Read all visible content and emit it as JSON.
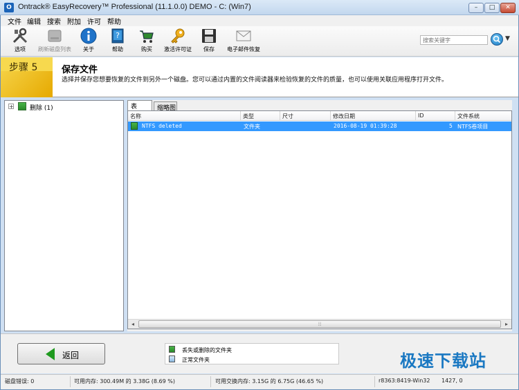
{
  "window": {
    "title": "Ontrack® EasyRecovery™ Professional (11.1.0.0) DEMO - C: (Win7)",
    "app_icon_text": "O",
    "min_glyph": "–",
    "max_glyph": "□",
    "close_glyph": "✕"
  },
  "menu": [
    "文件",
    "编辑",
    "搜索",
    "附加",
    "许可",
    "帮助"
  ],
  "toolbar": {
    "items": [
      {
        "label": "选项",
        "icon": "tools-icon",
        "enabled": true
      },
      {
        "label": "刷新磁盘列表",
        "icon": "disk-refresh-icon",
        "enabled": false
      },
      {
        "label": "关于",
        "icon": "info-icon",
        "enabled": true
      },
      {
        "label": "帮助",
        "icon": "help-book-icon",
        "enabled": true
      },
      {
        "label": "购买",
        "icon": "cart-icon",
        "enabled": true
      },
      {
        "label": "激活许可证",
        "icon": "key-icon",
        "enabled": true
      },
      {
        "label": "保存",
        "icon": "save-icon",
        "enabled": true
      },
      {
        "label": "电子邮件恢复",
        "icon": "email-icon",
        "enabled": true
      }
    ],
    "search_placeholder": "搜索关键字",
    "search_dropdown_glyph": "▼"
  },
  "step": {
    "label": "步骤 5",
    "title": "保存文件",
    "description": "选择并保存您想要恢复的文件到另外一个磁盘。您可以通过内置的文件阅读器来检验恢复的文件的质量，也可以使用关联应用程序打开文件。"
  },
  "tree": {
    "expander": "+",
    "items": [
      {
        "label": "删除 (1)"
      }
    ]
  },
  "tabs": [
    "表",
    "缩略图"
  ],
  "list": {
    "columns": [
      "名称",
      "类型",
      "尺寸",
      "修改日期",
      "ID",
      "文件系统"
    ],
    "rows": [
      {
        "name": "NTFS deleted",
        "type": "文件夹",
        "size": "",
        "modified": "2016-08-19 01:39:28",
        "id": "5",
        "fs": "NTFS卷项目"
      }
    ],
    "scroll_left": "◂",
    "scroll_right": "▸",
    "scroll_grip": "⦙⦙⦙"
  },
  "bottom": {
    "back_label": "返回",
    "legend": [
      "丢失或删除的文件夹",
      "正常文件夹"
    ],
    "watermark": "极速下载站"
  },
  "status": {
    "disk_errors": "磁盘错误: 0",
    "free_memory": "可用内存: 300.49M 的 3.38G (8.69 %)",
    "free_swap": "可用交换内存: 3.15G 的 6.75G (46.65 %)",
    "build": "r8363:8419-Win32",
    "count": "1427, 0"
  },
  "colors": {
    "selection": "#3399ff",
    "step_badge": "#f2c21b",
    "deleted_folder": "#2f9e2f",
    "watermark": "#1a78c2"
  }
}
